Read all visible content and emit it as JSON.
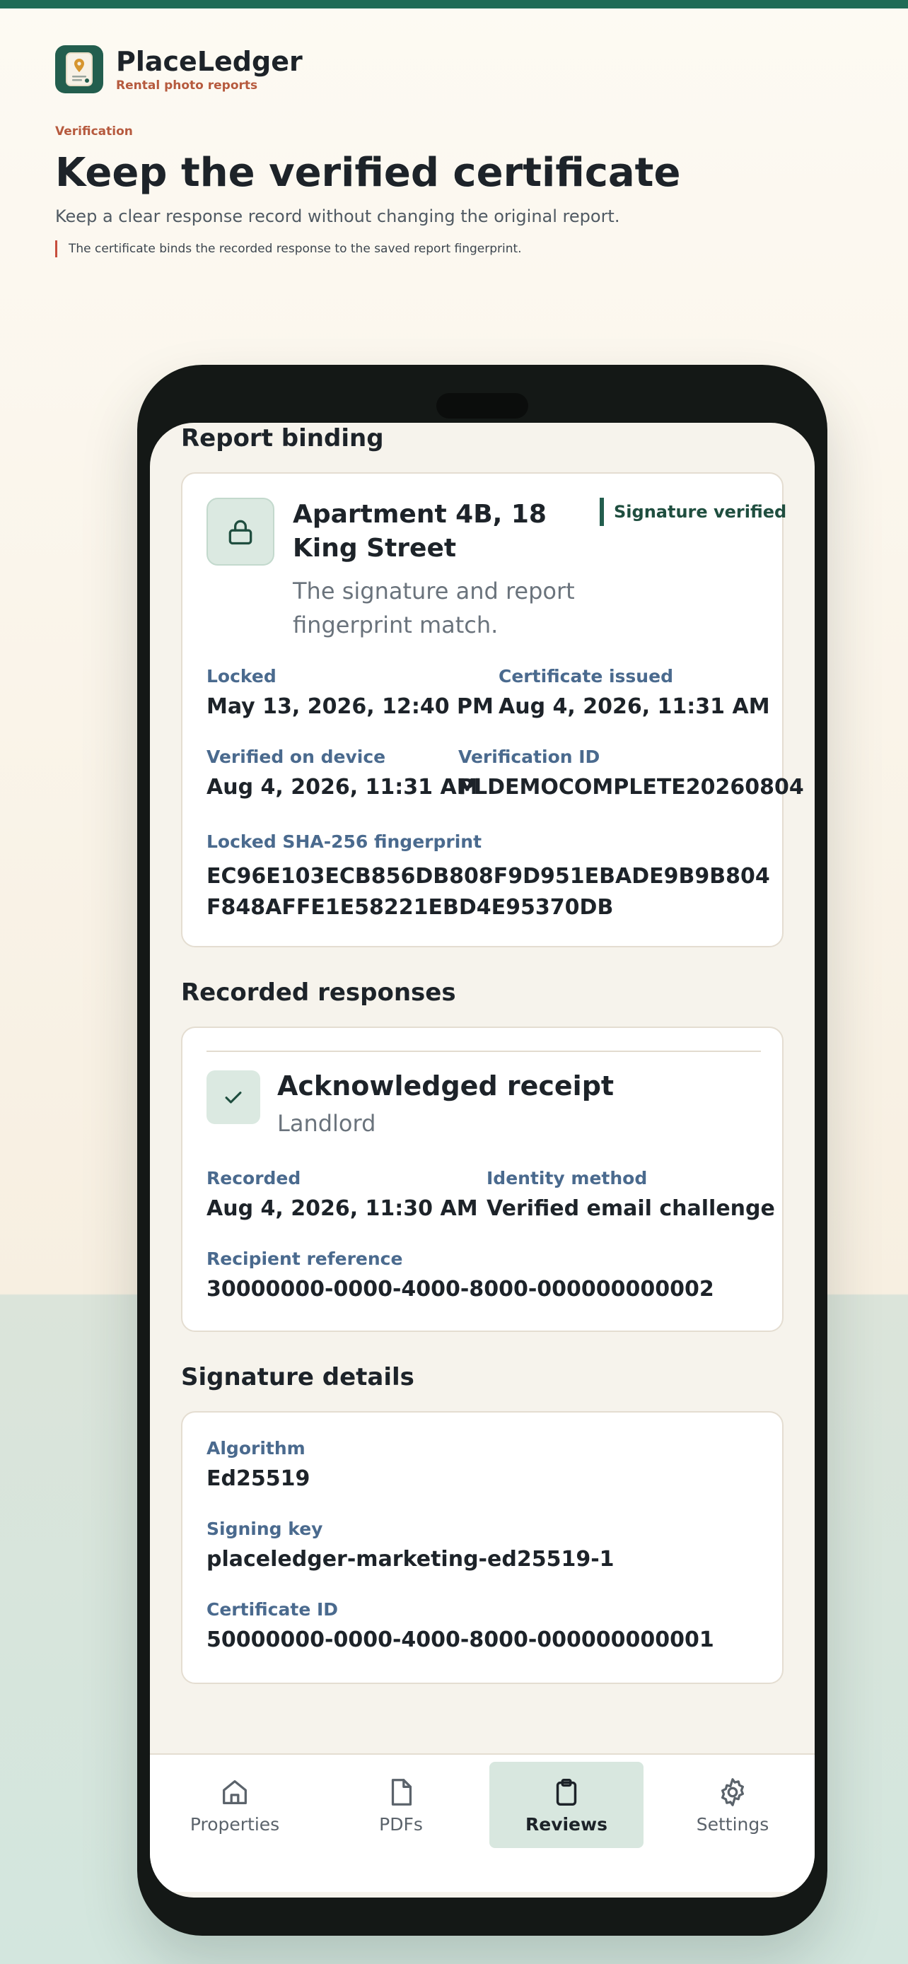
{
  "brand": {
    "name": "PlaceLedger",
    "tagline": "Rental photo reports"
  },
  "hero": {
    "eyebrow": "Verification",
    "title": "Keep the verified certificate",
    "subtitle": "Keep a clear response record without changing the original report.",
    "note": "The certificate binds the recorded response to the saved report fingerprint."
  },
  "binding": {
    "section_title": "Report binding",
    "property": "Apartment 4B, 18 King Street",
    "description": "The signature and report fingerprint match.",
    "badge": "Signature verified",
    "locked_label": "Locked",
    "locked_value": "May 13, 2026, 12:40 PM",
    "issued_label": "Certificate issued",
    "issued_value": "Aug 4, 2026, 11:31 AM",
    "verified_label": "Verified on device",
    "verified_value": "Aug 4, 2026, 11:31 AM",
    "verification_id_label": "Verification ID",
    "verification_id_value": "PLDEMOCOMPLETE20260804",
    "fingerprint_label": "Locked SHA-256 fingerprint",
    "fingerprint_value": "EC96E103ECB856DB808F9D951EBADE9B9B804F848AFFE1E58221EBD4E95370DB"
  },
  "responses": {
    "section_title": "Recorded responses",
    "title": "Acknowledged receipt",
    "role": "Landlord",
    "recorded_label": "Recorded",
    "recorded_value": "Aug 4, 2026, 11:30 AM",
    "identity_label": "Identity method",
    "identity_value": "Verified email challenge",
    "recipient_label": "Recipient reference",
    "recipient_value": "30000000-0000-4000-8000-000000000002"
  },
  "signature": {
    "section_title": "Signature details",
    "algorithm_label": "Algorithm",
    "algorithm_value": "Ed25519",
    "key_label": "Signing key",
    "key_value": "placeledger-marketing-ed25519-1",
    "cert_label": "Certificate ID",
    "cert_value": "50000000-0000-4000-8000-000000000001"
  },
  "nav": {
    "items": [
      {
        "label": "Properties",
        "icon": "home-icon"
      },
      {
        "label": "PDFs",
        "icon": "file-icon"
      },
      {
        "label": "Reviews",
        "icon": "clipboard-icon",
        "active": true
      },
      {
        "label": "Settings",
        "icon": "gear-icon"
      }
    ]
  },
  "colors": {
    "brand": "#235e4e",
    "accent": "#b65a3e",
    "label": "#4a6a8e"
  }
}
